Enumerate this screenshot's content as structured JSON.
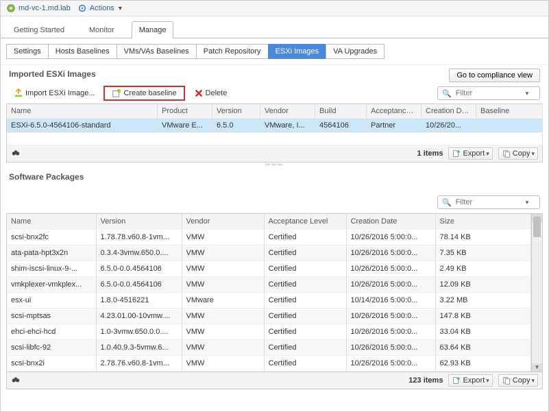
{
  "header": {
    "host": "md-vc-1.md.lab",
    "actions_label": "Actions"
  },
  "main_tabs": {
    "items": [
      "Getting Started",
      "Monitor",
      "Manage"
    ],
    "active": 2
  },
  "sub_tabs": {
    "items": [
      "Settings",
      "Hosts Baselines",
      "VMs/VAs Baselines",
      "Patch Repository",
      "ESXi Images",
      "VA Upgrades"
    ],
    "active": 4
  },
  "images_section": {
    "heading": "Imported ESXi Images",
    "compliance_button": "Go to compliance view",
    "toolbar": {
      "import": "Import ESXi Image...",
      "create": "Create baseline",
      "delete": "Delete"
    },
    "filter_placeholder": "Filter",
    "columns": [
      "Name",
      "Product",
      "Version",
      "Vendor",
      "Build",
      "Acceptance ...",
      "Creation Date",
      "Baseline"
    ],
    "rows": [
      {
        "name": "ESXi-6.5.0-4564106-standard",
        "product": "VMware E...",
        "version": "6.5.0",
        "vendor": "VMware, I...",
        "build": "4564106",
        "acceptance": "Partner",
        "creation": "10/26/20...",
        "baseline": ""
      }
    ],
    "item_count_label": "1 items",
    "export_label": "Export",
    "copy_label": "Copy"
  },
  "packages_section": {
    "heading": "Software Packages",
    "filter_placeholder": "Filter",
    "columns": [
      "Name",
      "Version",
      "Vendor",
      "Acceptance Level",
      "Creation Date",
      "Size"
    ],
    "rows": [
      {
        "name": "scsi-bnx2fc",
        "version": "1.78.78.v60.8-1vm...",
        "vendor": "VMW",
        "acceptance": "Certified",
        "creation": "10/26/2016 5:00:0...",
        "size": "78.14 KB"
      },
      {
        "name": "ata-pata-hpt3x2n",
        "version": "0.3.4-3vmw.650.0....",
        "vendor": "VMW",
        "acceptance": "Certified",
        "creation": "10/26/2016 5:00:0...",
        "size": "7.35 KB"
      },
      {
        "name": "shim-iscsi-linux-9-...",
        "version": "6.5.0-0.0.4564106",
        "vendor": "VMW",
        "acceptance": "Certified",
        "creation": "10/26/2016 5:00:0...",
        "size": "2.49 KB"
      },
      {
        "name": "vmkplexer-vmkplex...",
        "version": "6.5.0-0.0.4564106",
        "vendor": "VMW",
        "acceptance": "Certified",
        "creation": "10/26/2016 5:00:0...",
        "size": "12.09 KB"
      },
      {
        "name": "esx-ui",
        "version": "1.8.0-4516221",
        "vendor": "VMware",
        "acceptance": "Certified",
        "creation": "10/14/2016 5:00:0...",
        "size": "3.22 MB"
      },
      {
        "name": "scsi-mptsas",
        "version": "4.23.01.00-10vmw....",
        "vendor": "VMW",
        "acceptance": "Certified",
        "creation": "10/26/2016 5:00:0...",
        "size": "147.8 KB"
      },
      {
        "name": "ehci-ehci-hcd",
        "version": "1.0-3vmw.650.0.0....",
        "vendor": "VMW",
        "acceptance": "Certified",
        "creation": "10/26/2016 5:00:0...",
        "size": "33.04 KB"
      },
      {
        "name": "scsi-libfc-92",
        "version": "1.0.40.9.3-5vmw.6...",
        "vendor": "VMW",
        "acceptance": "Certified",
        "creation": "10/26/2016 5:00:0...",
        "size": "63.64 KB"
      },
      {
        "name": "scsi-bnx2i",
        "version": "2.78.76.v60.8-1vm...",
        "vendor": "VMW",
        "acceptance": "Certified",
        "creation": "10/26/2016 5:00:0...",
        "size": "62.93 KB"
      }
    ],
    "item_count_label": "123 items",
    "export_label": "Export",
    "copy_label": "Copy"
  }
}
